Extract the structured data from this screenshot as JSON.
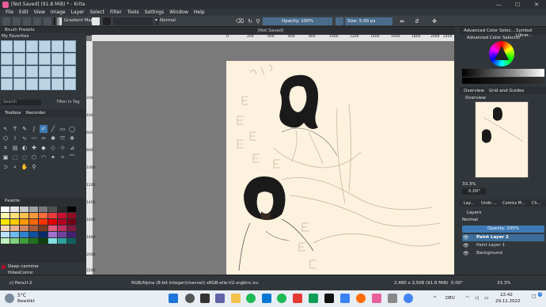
{
  "titlebar": {
    "title": "[Not Saved]  (91.8 MiB) * - Krita",
    "min": "—",
    "max": "☐",
    "close": "✕"
  },
  "menu": [
    "File",
    "Edit",
    "View",
    "Image",
    "Layer",
    "Select",
    "Filter",
    "Tools",
    "Settings",
    "Window",
    "Help"
  ],
  "toolbar": {
    "gradient_label": "Gradient Map",
    "blend_mode": "Normal",
    "opacity": "Opacity: 100%",
    "size": "Size: 5.00 px"
  },
  "document": {
    "tab": "[Not Saved]"
  },
  "ruler": {
    "h_ticks": [
      "0",
      "200",
      "400",
      "600",
      "800",
      "1000",
      "1200",
      "1400",
      "1600",
      "1800",
      "2000",
      "2200",
      "2400"
    ],
    "v_ticks": [
      "200",
      "400",
      "600",
      "800",
      "1000",
      "1200",
      "1400",
      "1600",
      "1800",
      "2000",
      "2200"
    ]
  },
  "left": {
    "brush_presets": "Brush Presets",
    "tag": "My Favorites",
    "search": "Search",
    "filter_in_tag": "Filter in Tag",
    "toolbox_tab": "Toolbox",
    "recorder_tab": "Recorder",
    "palette": "Palette",
    "color_name": "Deep carmine",
    "palette_name": "thkesComic"
  },
  "right": {
    "tab_color": "Advanced Color Selec...",
    "tab_symbol": "Symbol Librar...",
    "color_selector": "Advanced Color Selector",
    "tab_overview": "Overview",
    "tab_grid": "Grid and Guides",
    "overview_title": "Overview",
    "zoom": "33.3%",
    "rotation": "0.00°",
    "tabs2": [
      "Lay...",
      "Undo ...",
      "Comics M...",
      "Ch..."
    ],
    "layers_title": "Layers",
    "layer_blend": "Normal",
    "layer_opacity": "Opacity:  100%",
    "layers": [
      "Paint Layer 2",
      "Paint Layer 1",
      "Background"
    ]
  },
  "status": {
    "brush": "c) Pencil-2",
    "color_info": "RGB/Alpha (8-bit integer/channel)  sRGB-elle-V2-srgbtrc.icc",
    "dims": "2,480 x 3,508 (91.8 MiB)",
    "rot": "0.00°",
    "zoom": "33.3%"
  },
  "taskbar": {
    "weather_temp": "5°C",
    "weather_desc": "Bewölkt",
    "lang": "DEU",
    "time": "22:42",
    "date": "29.11.2022",
    "badge": "3"
  },
  "colors": {
    "accent": "#3d7ab5",
    "paper": "#fdf2de",
    "canvas_bg": "#7a7a7a",
    "selected_layer": "#3d6d99"
  }
}
